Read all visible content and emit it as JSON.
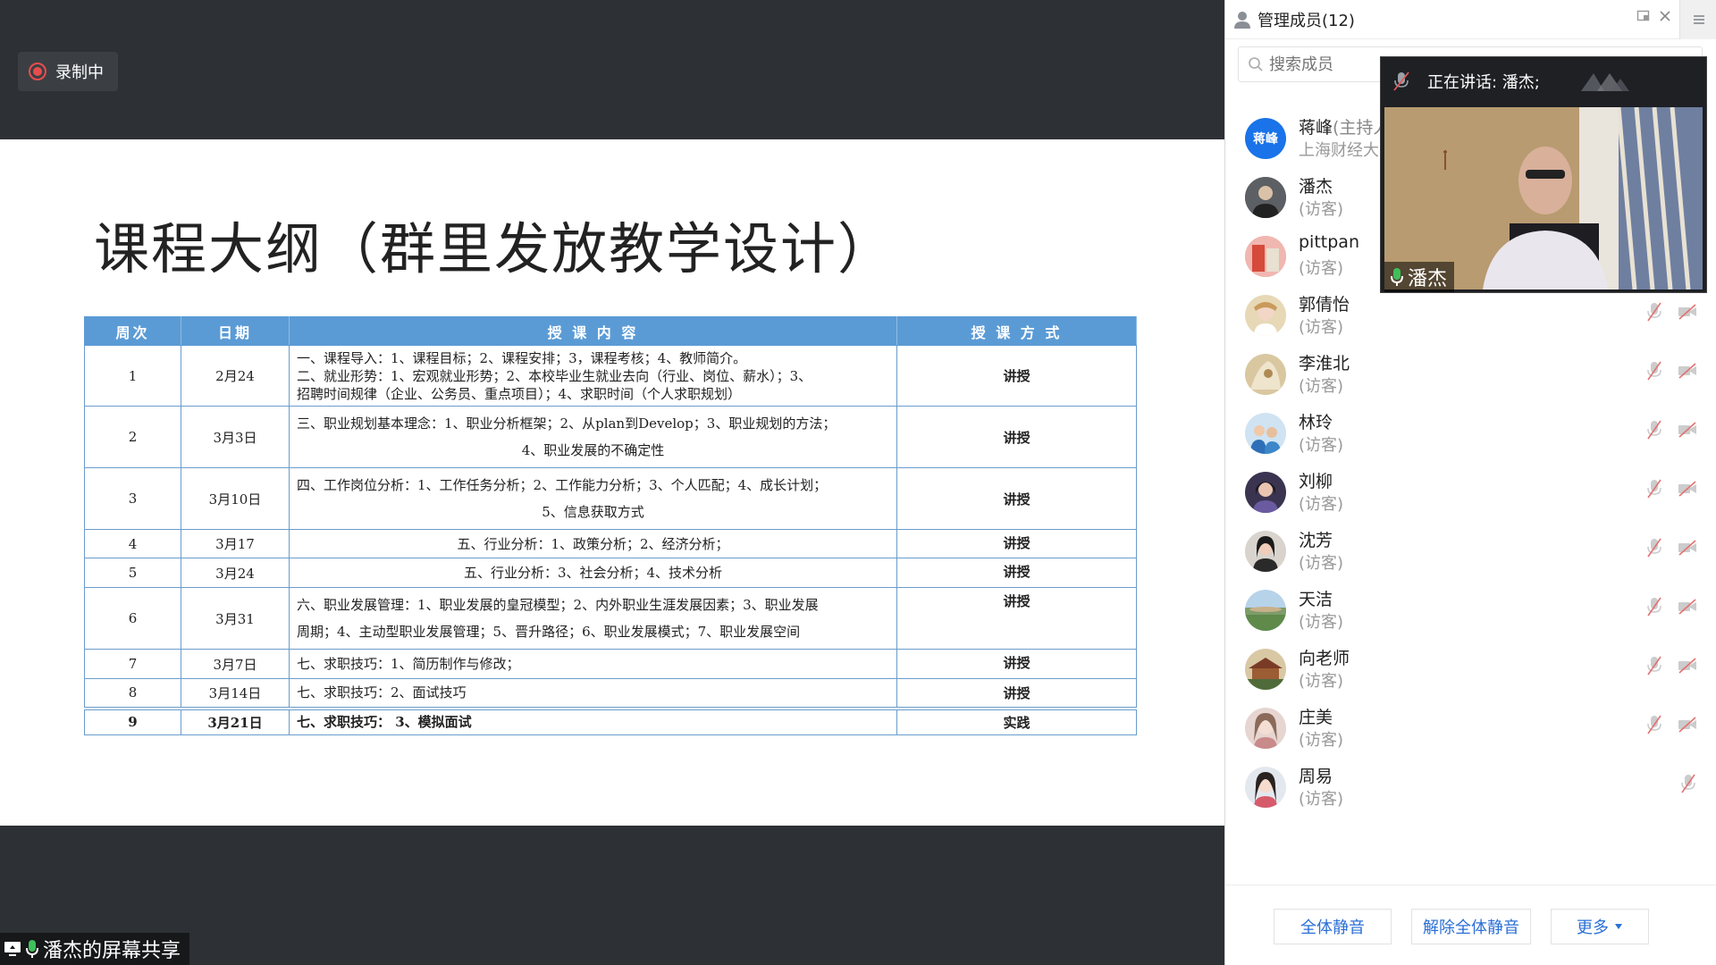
{
  "recording": {
    "label": "录制中",
    "color": "#e84d4d"
  },
  "slide": {
    "title": "课程大纲（群里发放教学设计）",
    "table": {
      "headers": [
        "周次",
        "日期",
        "授 课 内 容",
        "授 课 方 式"
      ],
      "rows": [
        {
          "week": "1",
          "date": "2月24",
          "content": [
            "一、课程导入：1、课程目标；2、课程安排；3，课程考核；4、教师简介。",
            "二、就业形势：1、宏观就业形势；2、本校毕业生就业去向（行业、岗位、薪水）；3、",
            "招聘时间规律（企业、公务员、重点项目）；4、求职时间（个人求职规划）"
          ],
          "method": "讲授"
        },
        {
          "week": "2",
          "date": "3月3日",
          "content": [
            "三、职业规划基本理念：1、职业分析框架；2、从plan到Develop；3、职业规划的方法；",
            "4、职业发展的不确定性"
          ],
          "method": "讲授"
        },
        {
          "week": "3",
          "date": "3月10日",
          "content": [
            "四、工作岗位分析：1、工作任务分析；2、工作能力分析；3、个人匹配；4、成长计划；",
            "5、信息获取方式"
          ],
          "method": "讲授"
        },
        {
          "week": "4",
          "date": "3月17",
          "content": [
            "五、行业分析：1、政策分析；2、经济分析；"
          ],
          "method": "讲授"
        },
        {
          "week": "5",
          "date": "3月24",
          "content": [
            "五、行业分析：3、社会分析；4、技术分析"
          ],
          "method": "讲授"
        },
        {
          "week": "6",
          "date": "3月31",
          "content": [
            "六、职业发展管理：1、职业发展的皇冠模型；2、内外职业生涯发展因素；3、职业发展",
            "周期；4、主动型职业发展管理；5、晋升路径；6、职业发展模式；7、职业发展空间"
          ],
          "method": "讲授"
        },
        {
          "week": "7",
          "date": "3月7日",
          "content": [
            "七、求职技巧：1、简历制作与修改；"
          ],
          "method": "讲授"
        },
        {
          "week": "8",
          "date": "3月14日",
          "content": [
            "七、求职技巧：2、面试技巧"
          ],
          "method": "讲授"
        },
        {
          "week": "9",
          "date": "3月21日",
          "content": [
            "七、求职技巧：  3、模拟面试"
          ],
          "method": "实践"
        }
      ]
    }
  },
  "share_label": "潘杰的屏幕共享",
  "panel": {
    "title": "管理成员(12)",
    "search_placeholder": "搜索成员",
    "members": [
      {
        "name": "蒋峰",
        "host_tag": "(主持人",
        "role": "上海财经大",
        "avatar_text": "蒋峰",
        "avatar_color": "#1a73e8"
      },
      {
        "name": "潘杰",
        "role": "(访客)"
      },
      {
        "name": "pittpan",
        "role": "(访客)"
      },
      {
        "name": "郭倩怡",
        "role": "(访客)"
      },
      {
        "name": "李淮北",
        "role": "(访客)"
      },
      {
        "name": "林玲",
        "role": "(访客)"
      },
      {
        "name": "刘柳",
        "role": "(访客)"
      },
      {
        "name": "沈芳",
        "role": "(访客)"
      },
      {
        "name": "天洁",
        "role": "(访客)"
      },
      {
        "name": "向老师",
        "role": "(访客)"
      },
      {
        "name": "庄美",
        "role": "(访客)"
      },
      {
        "name": "周易",
        "role": "(访客)"
      }
    ],
    "buttons": {
      "mute_all": "全体静音",
      "unmute_all": "解除全体静音",
      "more": "更多"
    },
    "accent": "#2b6fd6"
  },
  "video": {
    "speaking": "正在讲话: 潘杰;",
    "name": "潘杰"
  }
}
